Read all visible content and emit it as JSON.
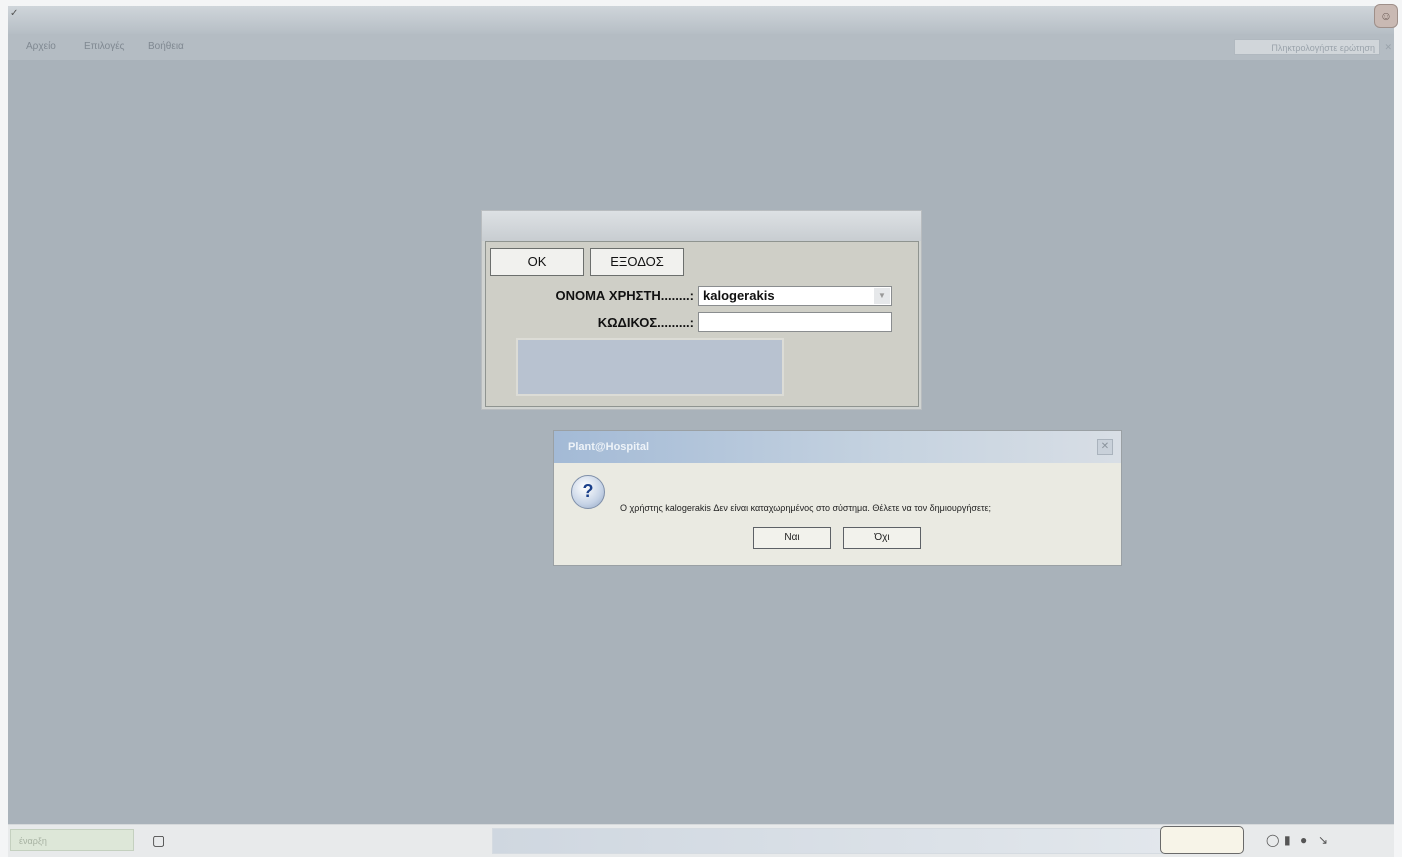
{
  "window": {
    "title": "",
    "menu": [
      "Αρχείο",
      "Επιλογές",
      "Βοήθεια"
    ],
    "help_field": "Πληκτρολογήστε ερώτηση"
  },
  "login_dialog": {
    "title": "",
    "ok_label": "OK",
    "exit_label": "ΕΞΟΔΟΣ",
    "username_label": "ΟΝΟΜΑ ΧΡΗΣΤΗ........:",
    "username_value": "kalogerakis",
    "password_label": "ΚΩΔΙΚΟΣ.........:",
    "password_value": "",
    "notice": ""
  },
  "message_box": {
    "title": "Plant@Hospital",
    "message": "Ο χρήστης kalogerakis Δεν είναι καταχωρημένος στο σύστημα. Θέλετε να τον δημιουργήσετε;",
    "yes_label": "Ναι",
    "no_label": "Όχι"
  },
  "taskbar": {
    "start_label": "έναρξη",
    "task_label": ""
  },
  "colors": {
    "desktop_bg": "#a9b2ba",
    "dialog_bg": "#cfcfc7",
    "message_bg": "#eaeae2"
  }
}
